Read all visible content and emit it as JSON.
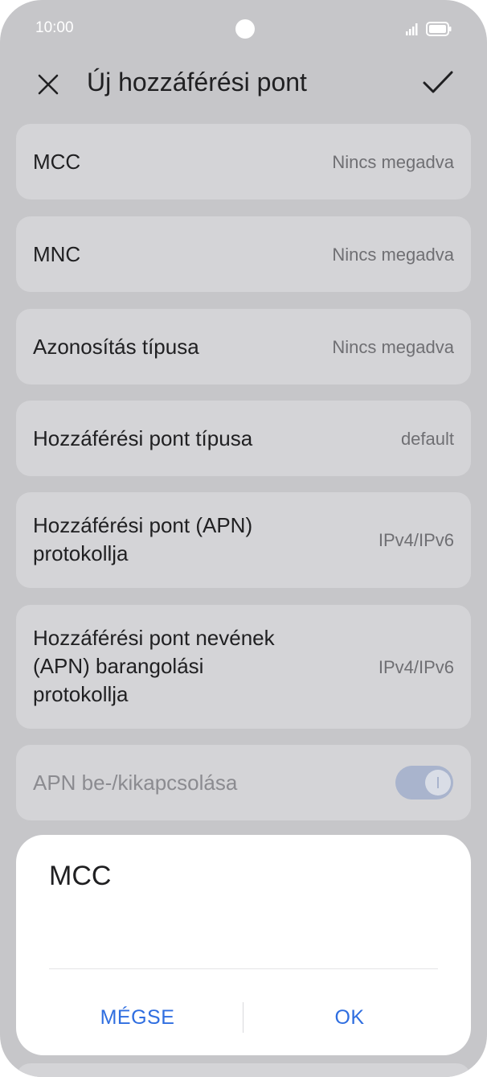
{
  "status_bar": {
    "time": "10:00"
  },
  "header": {
    "title": "Új hozzáférési pont",
    "close_icon": "close-icon",
    "confirm_icon": "check-icon"
  },
  "settings": [
    {
      "label": "MCC",
      "value": "Nincs megadva"
    },
    {
      "label": "MNC",
      "value": "Nincs megadva"
    },
    {
      "label": "Azonosítás típusa",
      "value": "Nincs megadva"
    },
    {
      "label": "Hozzáférési pont típusa",
      "value": "default"
    },
    {
      "label_lines": [
        "Hozzáférési pont (APN)",
        "protokollja"
      ],
      "value": "IPv4/IPv6"
    },
    {
      "label_lines": [
        "Hozzáférési pont nevének",
        "(APN) barangolási",
        "protokollja"
      ],
      "value": "IPv4/IPv6"
    },
    {
      "label": "APN be-/kikapcsolása",
      "toggle_on": true
    }
  ],
  "dialog": {
    "title": "MCC",
    "input_value": "",
    "cancel_label": "MÉGSE",
    "ok_label": "OK"
  },
  "colors": {
    "overlay_background": "#c6c6c9",
    "card": "#d4d4d7",
    "accent": "#2f6ee0",
    "toggle": "#a9b4cd"
  }
}
